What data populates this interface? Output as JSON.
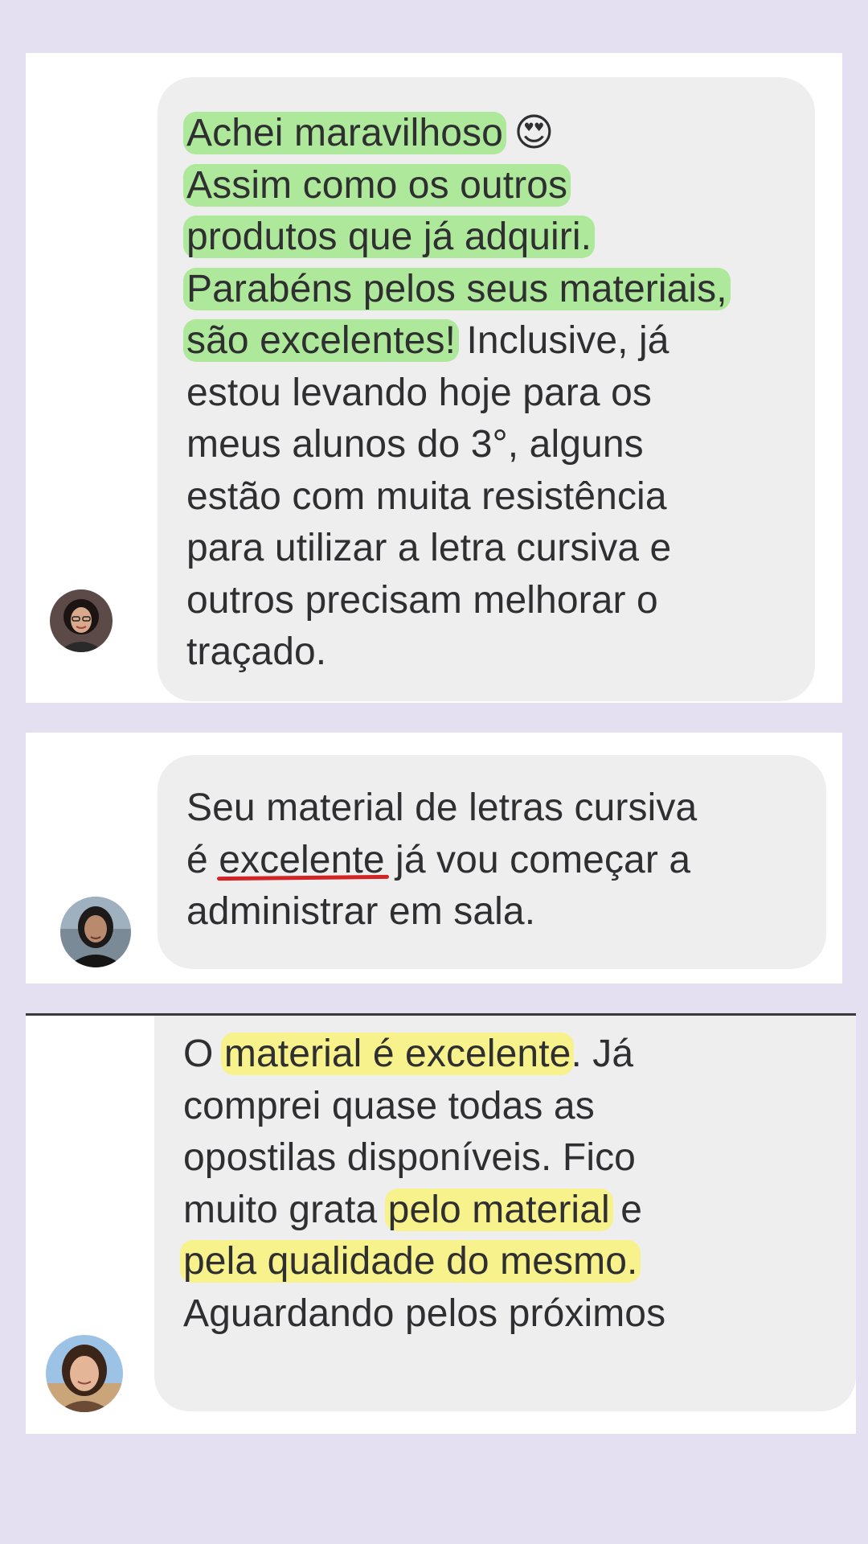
{
  "colors": {
    "page_background": "#e4e0f1",
    "card_background": "#ffffff",
    "bubble_background": "#eeeeef",
    "text": "#2f2f31",
    "highlight_green": "#96e678",
    "highlight_yellow": "#faf46e",
    "underline_red": "#d22424"
  },
  "messages": [
    {
      "avatar": "user-avatar-1",
      "lines": [
        [
          "Achei maravilhoso",
          " 😍"
        ],
        [
          "Assim como os outros"
        ],
        [
          "produtos que já adquiri."
        ],
        [
          "Parabéns pelos seus materiais,"
        ],
        [
          "são excelentes!",
          " Inclusive, já"
        ],
        [
          "estou levando hoje para os"
        ],
        [
          "meus alunos do 3°, alguns"
        ],
        [
          "estão com muita resistência"
        ],
        [
          "para utilizar a letra cursiva e"
        ],
        [
          "outros precisam melhorar o"
        ],
        [
          "traçado."
        ]
      ]
    },
    {
      "avatar": "user-avatar-2",
      "lines": [
        [
          "Seu material de letras cursiva"
        ],
        [
          "é ",
          "excelente",
          " já vou começar a"
        ],
        [
          "administrar em sala."
        ]
      ]
    },
    {
      "avatar": "user-avatar-3",
      "lines": [
        [
          "O ",
          "material é excelente",
          ".  Já"
        ],
        [
          "comprei quase todas as"
        ],
        [
          "opostilas disponíveis.  Fico"
        ],
        [
          "muito grata ",
          "pelo material",
          " e"
        ],
        [
          "pela qualidade do mesmo."
        ],
        [
          "Aguardando pelos próximos"
        ]
      ]
    }
  ]
}
